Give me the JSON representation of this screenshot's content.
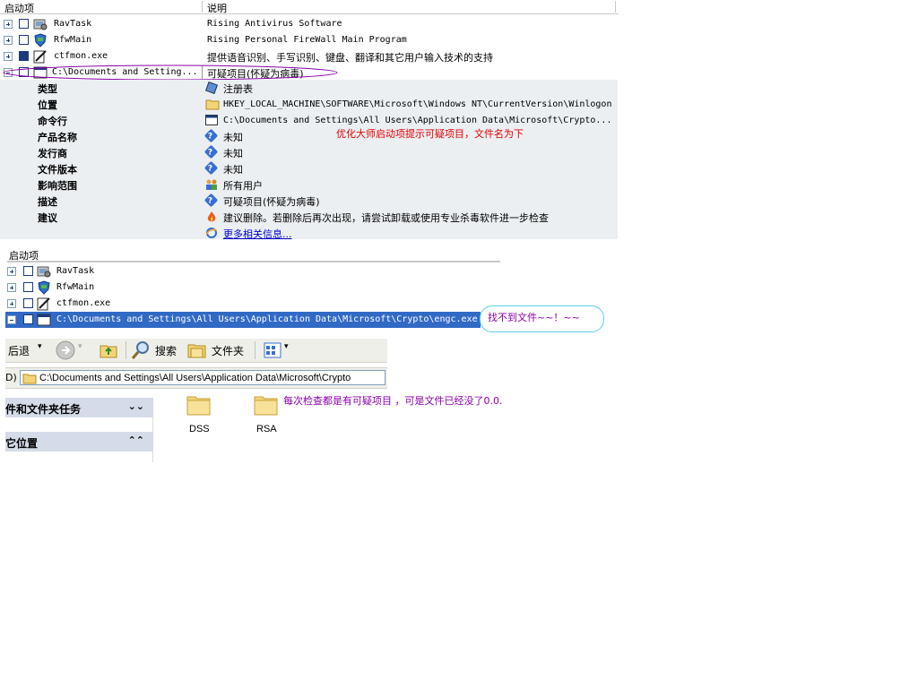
{
  "top_list": {
    "col_startup": "启动项",
    "col_desc": "说明",
    "rows": [
      {
        "name": "RavTask",
        "desc": "Rising Antivirus Software"
      },
      {
        "name": "RfwMain",
        "desc": "Rising Personal FireWall Main Program"
      },
      {
        "name": "ctfmon.exe",
        "desc": "提供语音识别、手写识别、键盘、翻译和其它用户输入技术的支持"
      },
      {
        "name": "C:\\Documents and Setting...",
        "desc": "可疑项目(怀疑为病毒)"
      }
    ]
  },
  "details": {
    "labels": {
      "type": "类型",
      "location": "位置",
      "command": "命令行",
      "product": "产品名称",
      "publisher": "发行商",
      "version": "文件版本",
      "scope": "影响范围",
      "description": "描述",
      "advice": "建议"
    },
    "values": {
      "type": "注册表",
      "location": "HKEY_LOCAL_MACHINE\\SOFTWARE\\Microsoft\\Windows NT\\CurrentVersion\\Winlogon",
      "command": "C:\\Documents and Settings\\All Users\\Application Data\\Microsoft\\Crypto...",
      "product": "未知",
      "publisher": "未知",
      "version": "未知",
      "scope": "所有用户",
      "description": "可疑项目(怀疑为病毒)",
      "advice": "建议删除。若删除后再次出现，请尝试卸载或使用专业杀毒软件进一步检查",
      "more_info": "更多相关信息..."
    },
    "annotation": "优化大师启动项提示可疑项目，文件名为下"
  },
  "second_list": {
    "col_startup": "启动项",
    "rows": [
      {
        "name": "RavTask"
      },
      {
        "name": "RfwMain"
      },
      {
        "name": "ctfmon.exe"
      },
      {
        "name": "C:\\Documents and Settings\\All Users\\Application Data\\Microsoft\\Crypto\\engc.exe"
      }
    ],
    "bubble": "找不到文件~~！~~"
  },
  "explorer": {
    "back_label": "后退",
    "search_label": "搜索",
    "folders_label": "文件夹",
    "address_prefix": "D)",
    "address": "C:\\Documents and Settings\\All Users\\Application Data\\Microsoft\\Crypto",
    "task_pane_1": "件和文件夹任务",
    "task_pane_2": "它位置",
    "folders": [
      {
        "name": "DSS"
      },
      {
        "name": "RSA"
      }
    ],
    "annotation": "每次检查都是有可疑项目 ，可是文件已经没了0.0."
  },
  "colors": {
    "selection": "#316ac5",
    "annotation_red": "#e00000",
    "annotation_purple": "#8a00a8",
    "panel_bg": "#eceff2",
    "link_blue": "#0000cc"
  }
}
